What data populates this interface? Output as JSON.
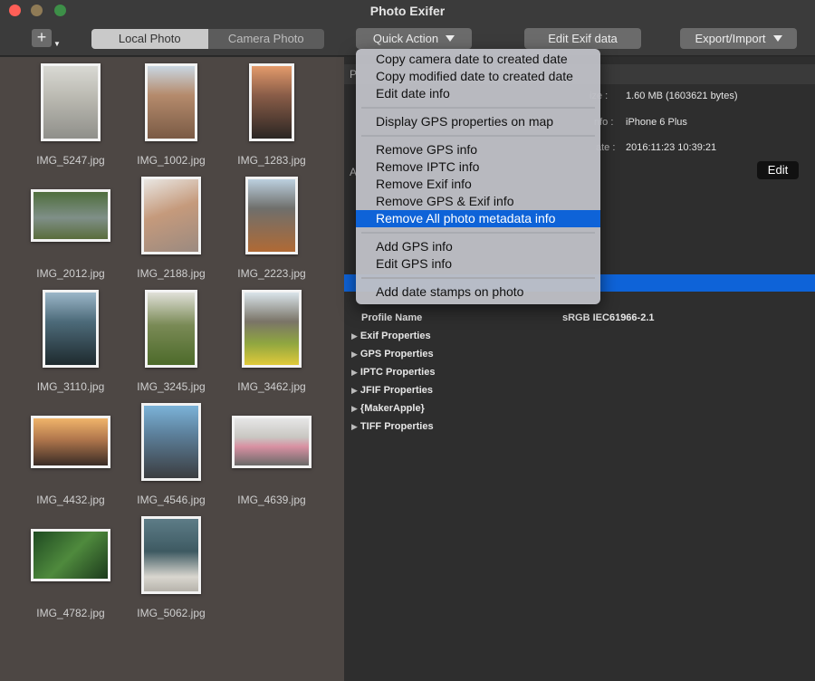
{
  "window": {
    "title": "Photo Exifer"
  },
  "toolbar": {
    "add_label": "+",
    "tabs": [
      "Local Photo",
      "Camera Photo"
    ],
    "quick_action": "Quick Action",
    "edit_exif": "Edit Exif data",
    "export_import": "Export/Import"
  },
  "photos": [
    "IMG_5247.jpg",
    "IMG_1002.jpg",
    "IMG_1283.jpg",
    "IMG_2012.jpg",
    "IMG_2188.jpg",
    "IMG_2223.jpg",
    "IMG_3110.jpg",
    "IMG_3245.jpg",
    "IMG_3462.jpg",
    "IMG_4432.jpg",
    "IMG_4546.jpg",
    "IMG_4639.jpg",
    "IMG_4782.jpg",
    "IMG_5062.jpg"
  ],
  "info": {
    "section1_header": "P",
    "size_label": "ize :",
    "size_value": "1.60 MB (1603621 bytes)",
    "device_label": "nfo :",
    "device_value": "iPhone 6 Plus",
    "date_label": "ate :",
    "date_value": "2016:11:23 10:39:21",
    "section2_header": "A",
    "edit_label": "Edit",
    "profile_label": "Profile Name",
    "profile_value": "sRGB IEC61966-2.1",
    "groups": [
      "Exif Properties",
      "GPS Properties",
      "IPTC Properties",
      "JFIF Properties",
      "{MakerApple}",
      "TIFF Properties"
    ]
  },
  "menu": {
    "items": [
      "Copy camera date to created date",
      "Copy modified date to created date",
      "Edit date info",
      "Display GPS properties on map",
      "Remove GPS info",
      "Remove IPTC info",
      "Remove Exif info",
      "Remove GPS & Exif info",
      "Remove All photo metadata info",
      "Add GPS info",
      "Edit GPS  info",
      "Add date stamps on photo"
    ],
    "highlighted": "Remove All photo metadata info"
  }
}
